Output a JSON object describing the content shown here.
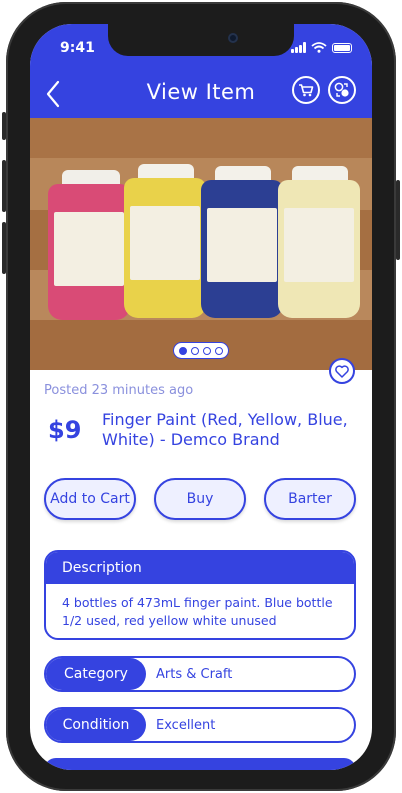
{
  "status_bar": {
    "time": "9:41"
  },
  "header": {
    "title": "View Item"
  },
  "listing": {
    "posted": "Posted 23 minutes ago",
    "price": "$9",
    "title": "Finger Paint (Red, Yellow, Blue, White) - Demco Brand",
    "image_carousel": {
      "total": 4,
      "active": 1
    }
  },
  "actions": {
    "add_to_cart": "Add to Cart",
    "buy": "Buy",
    "barter": "Barter"
  },
  "description": {
    "heading": "Description",
    "text": "4 bottles of 473mL finger paint. Blue bottle 1/2 used, red yellow white unused"
  },
  "details": {
    "category_label": "Category",
    "category_value": "Arts & Craft",
    "condition_label": "Condition",
    "condition_value": "Excellent"
  },
  "colors": {
    "accent": "#3543e0",
    "light": "#eef0ff"
  }
}
